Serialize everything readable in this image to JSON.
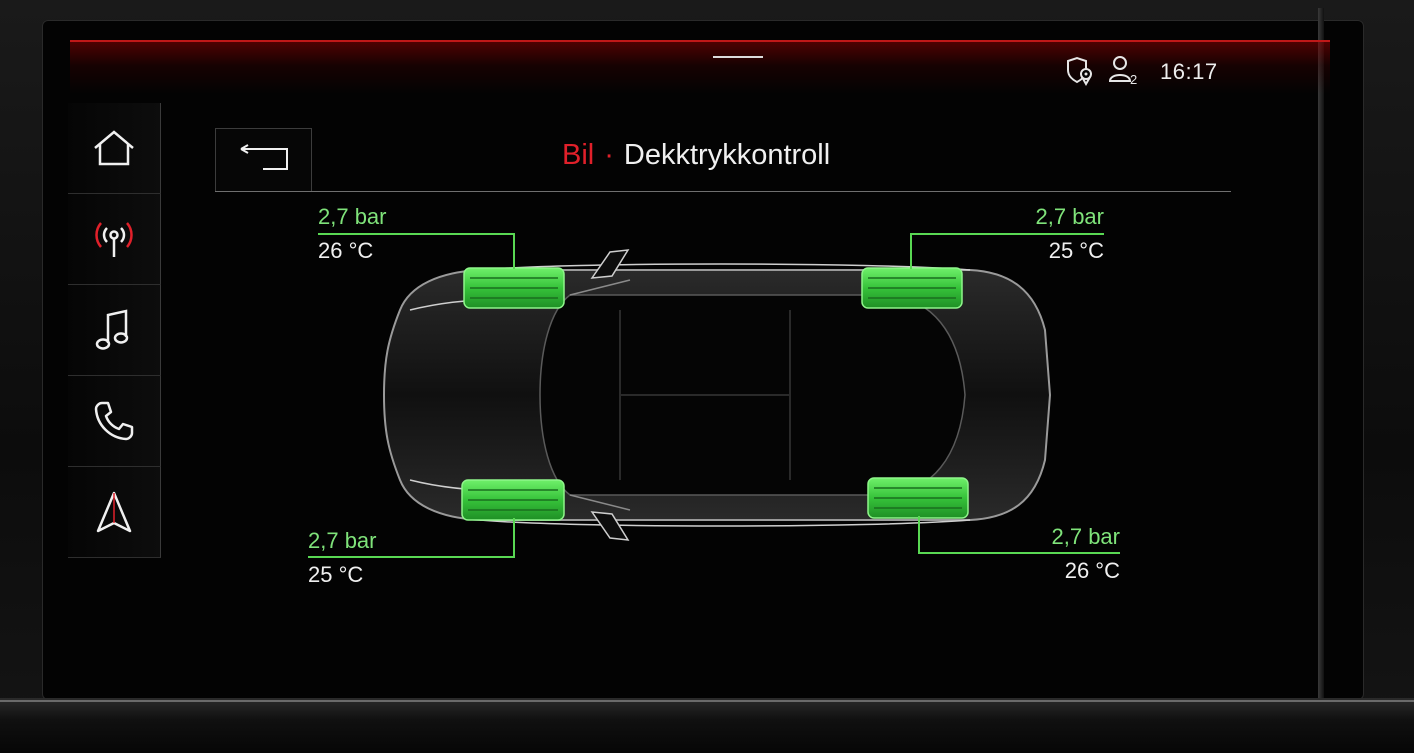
{
  "status_bar": {
    "time": "16:17",
    "icons": [
      "location-shield-icon",
      "user-profile-icon"
    ],
    "profile_number": "2"
  },
  "nav": {
    "items": [
      {
        "icon": "home-icon"
      },
      {
        "icon": "radio-icon"
      },
      {
        "icon": "music-note-icon"
      },
      {
        "icon": "phone-icon"
      },
      {
        "icon": "navigation-icon"
      }
    ]
  },
  "header": {
    "breadcrumb": "Bil",
    "separator": "·",
    "title": "Dekktrykkontroll",
    "back_icon": "back-arrow-icon"
  },
  "tires": {
    "front_left": {
      "pressure": "2,7 bar",
      "temperature": "26 °C"
    },
    "front_right": {
      "pressure": "2,7 bar",
      "temperature": "25 °C"
    },
    "rear_left": {
      "pressure": "2,7 bar",
      "temperature": "25 °C"
    },
    "rear_right": {
      "pressure": "2,7 bar",
      "temperature": "26 °C"
    }
  },
  "colors": {
    "accent_red": "#e0202a",
    "tire_ok_green": "#59d853",
    "text": "#f0f0f0"
  }
}
